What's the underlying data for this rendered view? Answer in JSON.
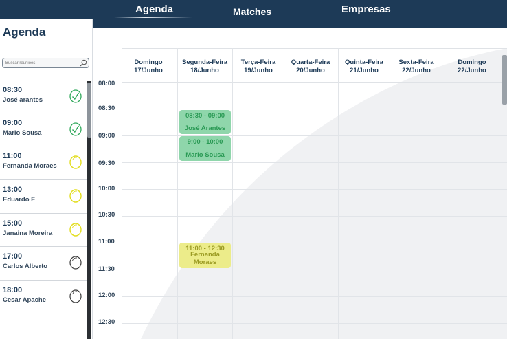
{
  "nav": {
    "tabs": [
      {
        "label": "Agenda",
        "active": true
      },
      {
        "label": "Matches",
        "active": false
      },
      {
        "label": "Empresas",
        "active": false
      }
    ]
  },
  "sidebar": {
    "title": "Agenda",
    "search": {
      "placeholder": "Buscar reuniões",
      "value": ""
    },
    "meetings": [
      {
        "time": "08:30",
        "name": "José arantes",
        "status": "done",
        "status_icon": "check-circle-icon"
      },
      {
        "time": "09:00",
        "name": "Mario Sousa",
        "status": "done",
        "status_icon": "check-circle-icon"
      },
      {
        "time": "11:00",
        "name": "Fernanda Moraes",
        "status": "pending",
        "status_icon": "circle-icon"
      },
      {
        "time": "13:00",
        "name": "Eduardo F",
        "status": "pending",
        "status_icon": "circle-icon"
      },
      {
        "time": "15:00",
        "name": "Janaina Moreira",
        "status": "pending",
        "status_icon": "circle-icon"
      },
      {
        "time": "17:00",
        "name": "Carlos Alberto",
        "status": "open",
        "status_icon": "circle-icon"
      },
      {
        "time": "18:00",
        "name": "Cesar Apache",
        "status": "open",
        "status_icon": "circle-icon"
      }
    ]
  },
  "calendar": {
    "days": [
      {
        "name": "Domingo",
        "date": "17/Junho"
      },
      {
        "name": "Segunda-Feira",
        "date": "18/Junho"
      },
      {
        "name": "Terça-Feira",
        "date": "19/Junho"
      },
      {
        "name": "Quarta-Feira",
        "date": "20/Junho"
      },
      {
        "name": "Quinta-Feira",
        "date": "21/Junho"
      },
      {
        "name": "Sexta-Feira",
        "date": "22/Junho"
      },
      {
        "name": "Domingo",
        "date": "22/Junho"
      }
    ],
    "times": [
      "08:00",
      "08:30",
      "09:00",
      "09:30",
      "10:00",
      "10:30",
      "11:00",
      "11:30",
      "12:00",
      "12:30"
    ],
    "events": [
      {
        "time": "08:30 - 09:00",
        "name": "José Arantes",
        "day": "Segunda-Feira",
        "status": "done"
      },
      {
        "time": "9:00 - 10:00",
        "name": "Mario Sousa",
        "day": "Segunda-Feira",
        "status": "done"
      },
      {
        "time": "11:00 - 12:30",
        "name": "Fernanda Moraes",
        "day": "Segunda-Feira",
        "status": "pending"
      }
    ]
  },
  "colors": {
    "navy": "#1d3a57",
    "done": "#2fa85a",
    "pending": "#e2dd1c",
    "open": "#3a3a3a"
  }
}
